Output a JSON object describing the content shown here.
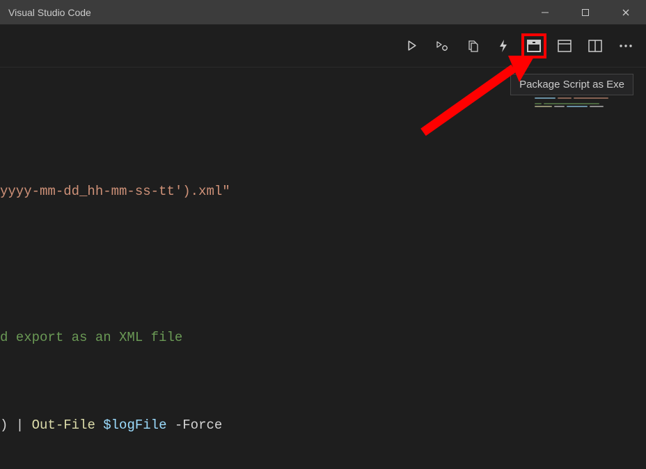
{
  "titleBar": {
    "title": "Visual Studio Code"
  },
  "toolbar": {
    "tooltip": "Package Script as Exe"
  },
  "editor": {
    "line1_string": "yyyy-mm-dd_hh-mm-ss-tt').xml\"",
    "line2_blank": "",
    "line3_comment_tail": "d export as an XML file",
    "line4_num_tail": ")",
    "line4_pipe": " | ",
    "line4_cmd": "Out-File",
    "line4_space": " ",
    "line4_var": "$logFile",
    "line4_param": " -Force"
  }
}
